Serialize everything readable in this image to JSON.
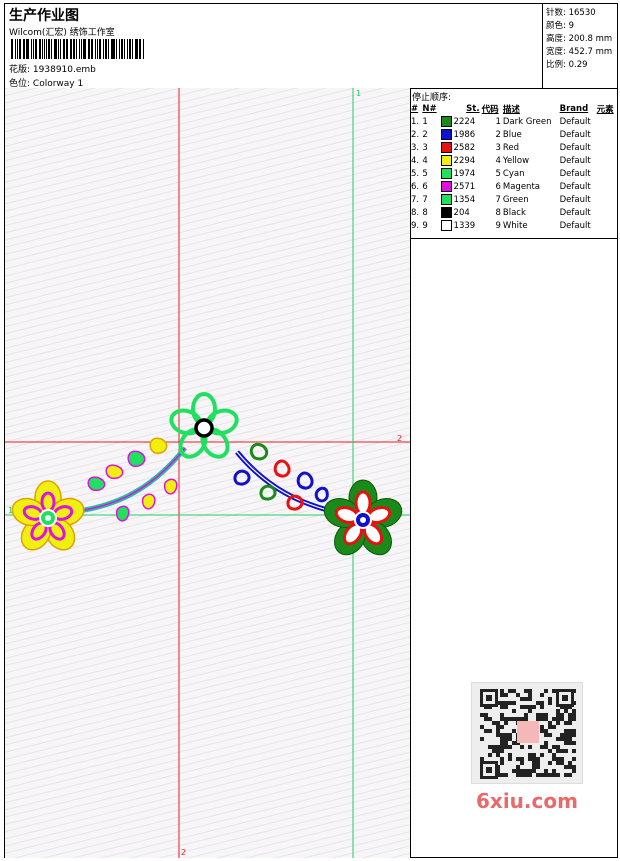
{
  "header": {
    "title": "生产作业图",
    "company": "Wilcom(汇宏) 绣饰工作室",
    "design_label": "花版:",
    "design_file": "1938910.emb",
    "colorway_label": "色位:",
    "colorway_name": "Colorway 1"
  },
  "stats": [
    {
      "label": "针数",
      "value": "16530"
    },
    {
      "label": "颜色",
      "value": "9"
    },
    {
      "label": "高度",
      "value": "200.8 mm"
    },
    {
      "label": "宽度",
      "value": "452.7 mm"
    },
    {
      "label": "比例",
      "value": "0.29"
    }
  ],
  "stop_sequence": {
    "title": "停止顺序:",
    "headers": [
      "#",
      "N#",
      "St.",
      "代码",
      "描述",
      "Brand",
      "元素"
    ],
    "rows": [
      {
        "num": "1.",
        "n": "1",
        "color": "#1a8a1a",
        "st": "2224",
        "code": "1",
        "desc": "Dark Green",
        "brand": "Default"
      },
      {
        "num": "2.",
        "n": "2",
        "color": "#1010d0",
        "st": "1986",
        "code": "2",
        "desc": "Blue",
        "brand": "Default"
      },
      {
        "num": "3.",
        "n": "3",
        "color": "#e81010",
        "st": "2582",
        "code": "3",
        "desc": "Red",
        "brand": "Default"
      },
      {
        "num": "4.",
        "n": "4",
        "color": "#f0f010",
        "st": "2294",
        "code": "4",
        "desc": "Yellow",
        "brand": "Default"
      },
      {
        "num": "5.",
        "n": "5",
        "color": "#20e060",
        "st": "1974",
        "code": "5",
        "desc": "Cyan",
        "brand": "Default"
      },
      {
        "num": "6.",
        "n": "6",
        "color": "#e010e0",
        "st": "2571",
        "code": "6",
        "desc": "Magenta",
        "brand": "Default"
      },
      {
        "num": "7.",
        "n": "7",
        "color": "#20e060",
        "st": "1354",
        "code": "7",
        "desc": "Green",
        "brand": "Default"
      },
      {
        "num": "8.",
        "n": "8",
        "color": "#000000",
        "st": "204",
        "code": "8",
        "desc": "Black",
        "brand": "Default"
      },
      {
        "num": "9.",
        "n": "9",
        "color": "#ffffff",
        "st": "1339",
        "code": "9",
        "desc": "White",
        "brand": "Default"
      }
    ]
  },
  "guides": {
    "h1": "1",
    "h2": "2",
    "v1": "1",
    "v2": "2"
  },
  "watermark": "6xiu.com"
}
